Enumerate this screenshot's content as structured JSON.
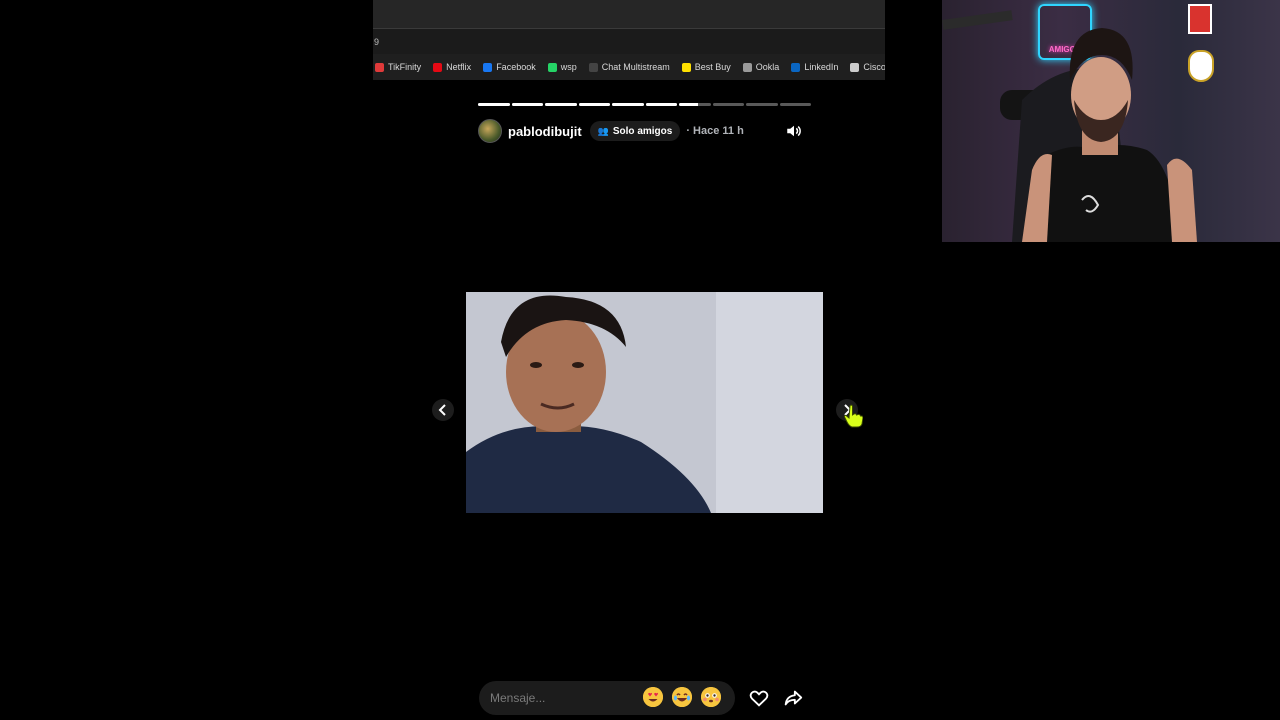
{
  "browser": {
    "address_fragment": "9",
    "bookmarks": [
      {
        "label": "TikFinity",
        "icon": "tikfinity-icon",
        "color": "#e03a3a"
      },
      {
        "label": "Netflix",
        "icon": "netflix-icon",
        "color": "#e50914"
      },
      {
        "label": "Facebook",
        "icon": "facebook-icon",
        "color": "#1877f2"
      },
      {
        "label": "wsp",
        "icon": "whatsapp-icon",
        "color": "#25d366"
      },
      {
        "label": "Chat Multistream",
        "icon": "chat-icon",
        "color": "#444444"
      },
      {
        "label": "Best Buy",
        "icon": "bestbuy-icon",
        "color": "#ffe000"
      },
      {
        "label": "Ookla",
        "icon": "ookla-icon",
        "color": "#9a9a9a"
      },
      {
        "label": "LinkedIn",
        "icon": "linkedin-icon",
        "color": "#0a66c2"
      },
      {
        "label": "Cisco",
        "icon": "cisco-icon",
        "color": "#cccccc"
      }
    ]
  },
  "story": {
    "username": "pablodibujit",
    "audience": "Solo amigos",
    "time": "· Hace 11 h",
    "progress_segments": [
      1,
      1,
      1,
      1,
      1,
      1,
      0.6,
      0,
      0,
      0
    ],
    "message_placeholder": "Mensaje...",
    "reactions": [
      "😍",
      "😂",
      "😳"
    ]
  },
  "colors": {
    "background": "#000000",
    "pill_bg": "#1c1c1c",
    "accent_neon_cyan": "#2fd5ff",
    "accent_neon_pink": "#ff6ac8"
  }
}
